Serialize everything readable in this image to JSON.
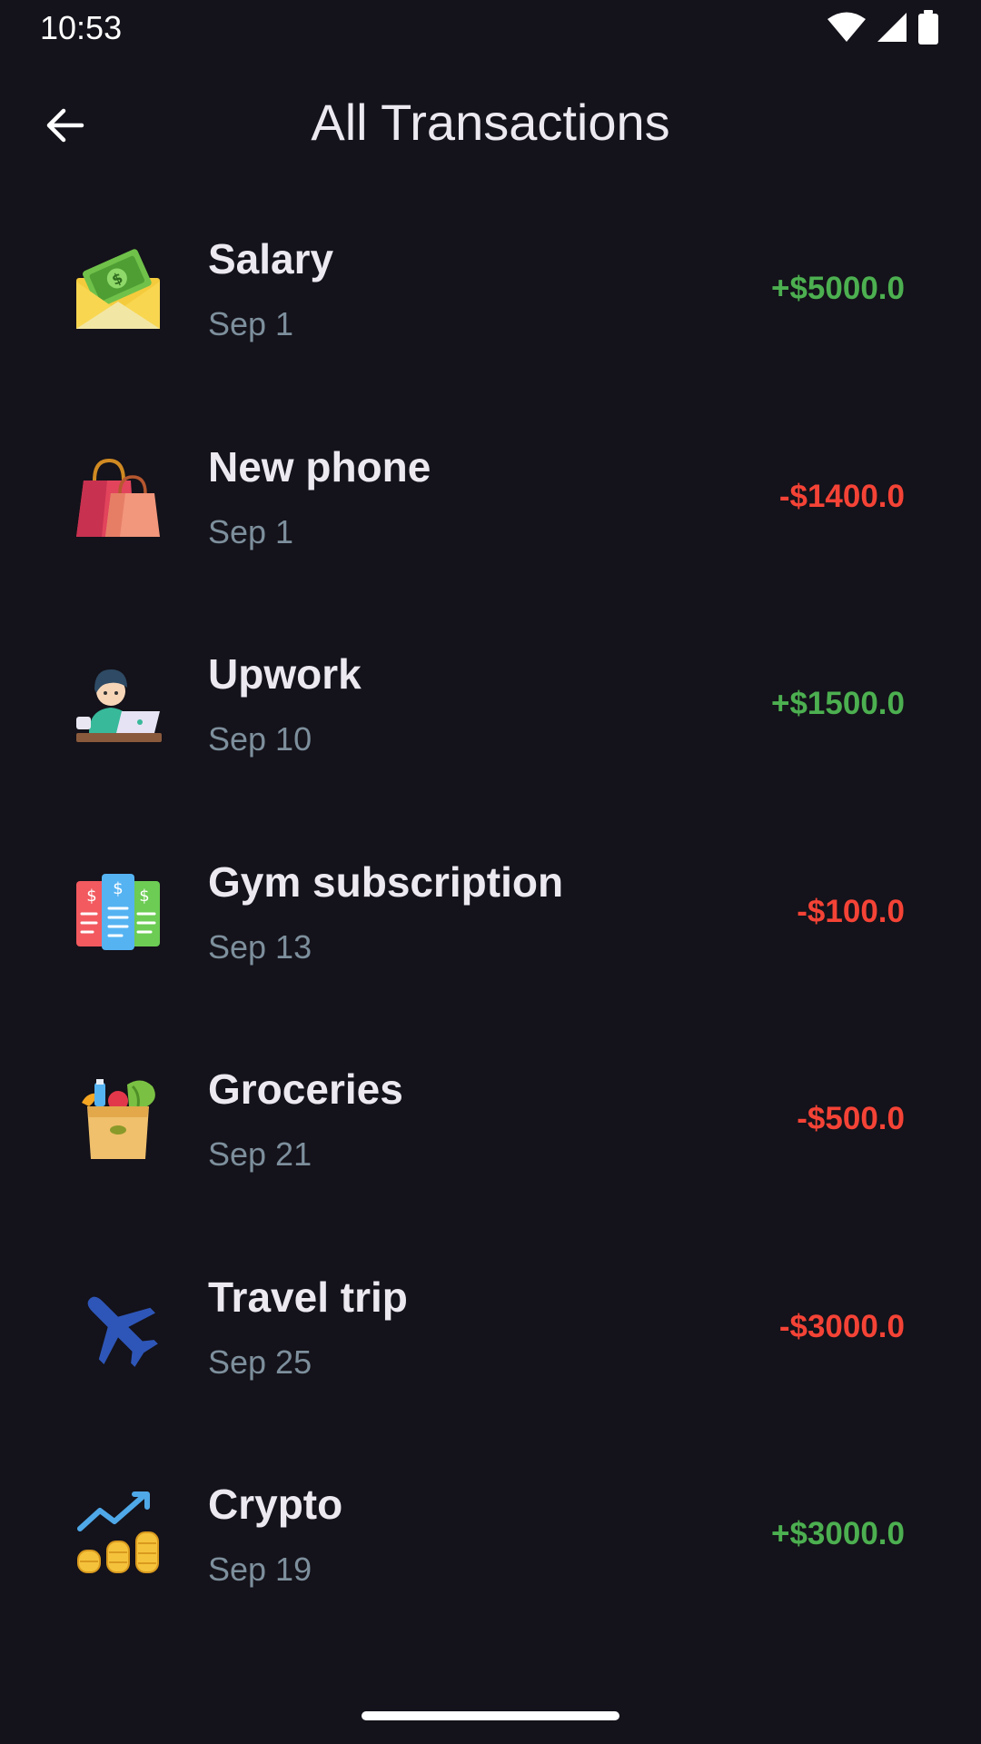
{
  "status_bar": {
    "time": "10:53",
    "icons": [
      "wifi-icon",
      "signal-icon",
      "battery-icon"
    ]
  },
  "app_bar": {
    "back_icon": "back-arrow-icon",
    "title": "All Transactions"
  },
  "colors": {
    "background": "#14121a",
    "income": "#4caf50",
    "expense": "#f44336",
    "date_text": "#7d8f9c"
  },
  "transactions": [
    {
      "name": "Salary",
      "date": "Sep 1",
      "amount": "+$5000.0",
      "type": "income",
      "icon": "salary-envelope-icon"
    },
    {
      "name": "New phone",
      "date": "Sep 1",
      "amount": "-$1400.0",
      "type": "expense",
      "icon": "shopping-bags-icon"
    },
    {
      "name": "Upwork",
      "date": "Sep 10",
      "amount": "+$1500.0",
      "type": "income",
      "icon": "freelancer-laptop-icon"
    },
    {
      "name": "Gym subscription",
      "date": "Sep 13",
      "amount": "-$100.0",
      "type": "expense",
      "icon": "receipts-icon"
    },
    {
      "name": "Groceries",
      "date": "Sep 21",
      "amount": "-$500.0",
      "type": "expense",
      "icon": "grocery-bag-icon"
    },
    {
      "name": "Travel trip",
      "date": "Sep 25",
      "amount": "-$3000.0",
      "type": "expense",
      "icon": "airplane-icon"
    },
    {
      "name": "Crypto",
      "date": "Sep 19",
      "amount": "+$3000.0",
      "type": "income",
      "icon": "coins-growth-icon"
    }
  ]
}
